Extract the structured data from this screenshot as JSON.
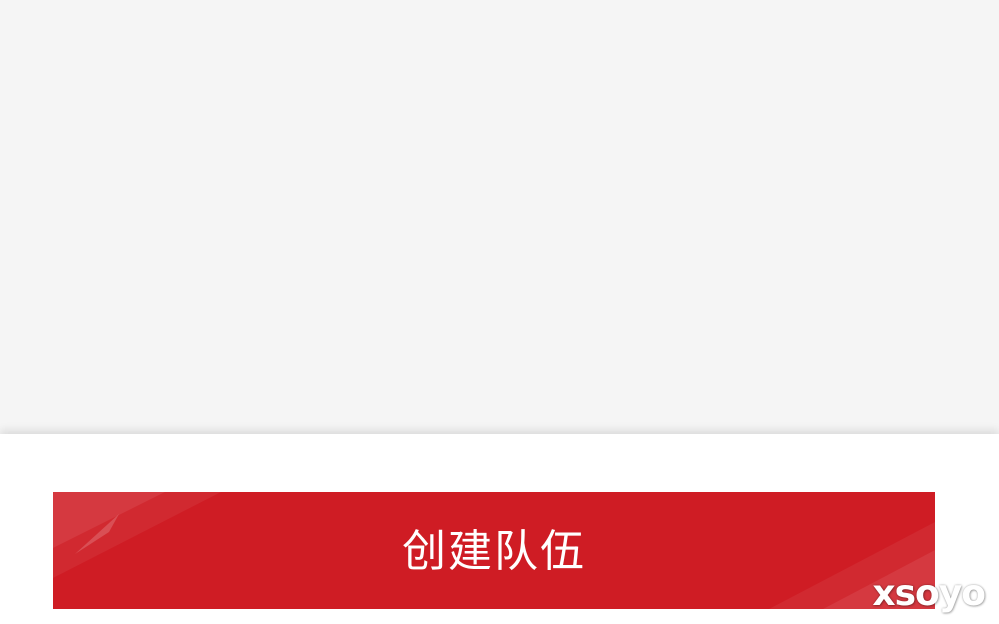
{
  "colors": {
    "content_background": "#f5f5f5",
    "bottom_bar_background": "#ffffff",
    "button_background": "#cf1c24",
    "button_text": "#ffffff"
  },
  "actions": {
    "create_team_label": "创建队伍"
  },
  "watermark": {
    "text": "xsoyo"
  }
}
